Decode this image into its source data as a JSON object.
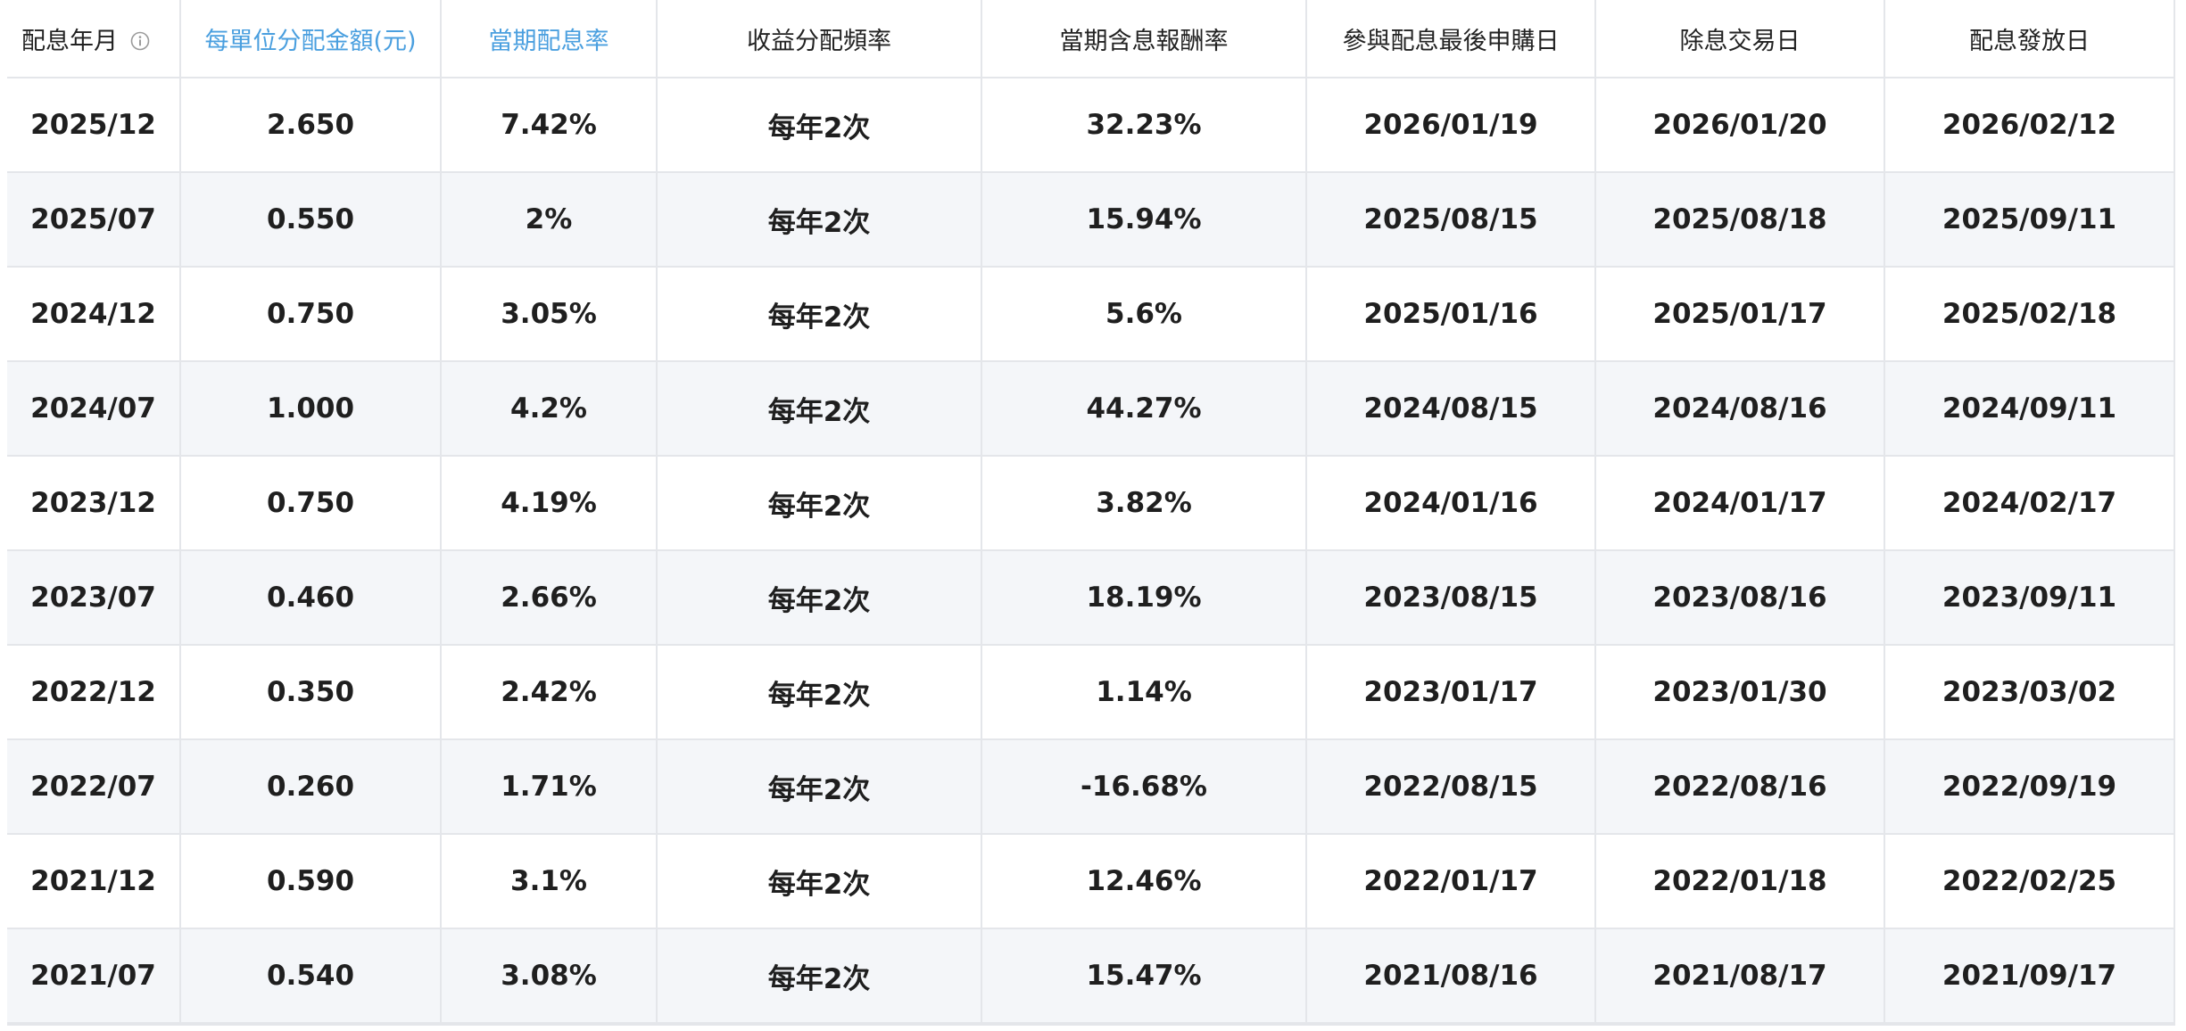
{
  "headers": {
    "month": "配息年月",
    "amount": "每單位分配金額(元)",
    "rate": "當期配息率",
    "frequency": "收益分配頻率",
    "total_return": "當期含息報酬率",
    "last_purchase": "參與配息最後申購日",
    "ex_date": "除息交易日",
    "pay_date": "配息發放日"
  },
  "colors": {
    "link_header": "#4a9fdf",
    "row_stripe": "#f4f6f9",
    "border": "#e4e6ea"
  },
  "rows": [
    {
      "month": "2025/12",
      "amount": "2.650",
      "rate": "7.42%",
      "frequency": "每年2次",
      "total_return": "32.23%",
      "last_purchase": "2026/01/19",
      "ex_date": "2026/01/20",
      "pay_date": "2026/02/12"
    },
    {
      "month": "2025/07",
      "amount": "0.550",
      "rate": "2%",
      "frequency": "每年2次",
      "total_return": "15.94%",
      "last_purchase": "2025/08/15",
      "ex_date": "2025/08/18",
      "pay_date": "2025/09/11"
    },
    {
      "month": "2024/12",
      "amount": "0.750",
      "rate": "3.05%",
      "frequency": "每年2次",
      "total_return": "5.6%",
      "last_purchase": "2025/01/16",
      "ex_date": "2025/01/17",
      "pay_date": "2025/02/18"
    },
    {
      "month": "2024/07",
      "amount": "1.000",
      "rate": "4.2%",
      "frequency": "每年2次",
      "total_return": "44.27%",
      "last_purchase": "2024/08/15",
      "ex_date": "2024/08/16",
      "pay_date": "2024/09/11"
    },
    {
      "month": "2023/12",
      "amount": "0.750",
      "rate": "4.19%",
      "frequency": "每年2次",
      "total_return": "3.82%",
      "last_purchase": "2024/01/16",
      "ex_date": "2024/01/17",
      "pay_date": "2024/02/17"
    },
    {
      "month": "2023/07",
      "amount": "0.460",
      "rate": "2.66%",
      "frequency": "每年2次",
      "total_return": "18.19%",
      "last_purchase": "2023/08/15",
      "ex_date": "2023/08/16",
      "pay_date": "2023/09/11"
    },
    {
      "month": "2022/12",
      "amount": "0.350",
      "rate": "2.42%",
      "frequency": "每年2次",
      "total_return": "1.14%",
      "last_purchase": "2023/01/17",
      "ex_date": "2023/01/30",
      "pay_date": "2023/03/02"
    },
    {
      "month": "2022/07",
      "amount": "0.260",
      "rate": "1.71%",
      "frequency": "每年2次",
      "total_return": "-16.68%",
      "last_purchase": "2022/08/15",
      "ex_date": "2022/08/16",
      "pay_date": "2022/09/19"
    },
    {
      "month": "2021/12",
      "amount": "0.590",
      "rate": "3.1%",
      "frequency": "每年2次",
      "total_return": "12.46%",
      "last_purchase": "2022/01/17",
      "ex_date": "2022/01/18",
      "pay_date": "2022/02/25"
    },
    {
      "month": "2021/07",
      "amount": "0.540",
      "rate": "3.08%",
      "frequency": "每年2次",
      "total_return": "15.47%",
      "last_purchase": "2021/08/16",
      "ex_date": "2021/08/17",
      "pay_date": "2021/09/17"
    }
  ]
}
